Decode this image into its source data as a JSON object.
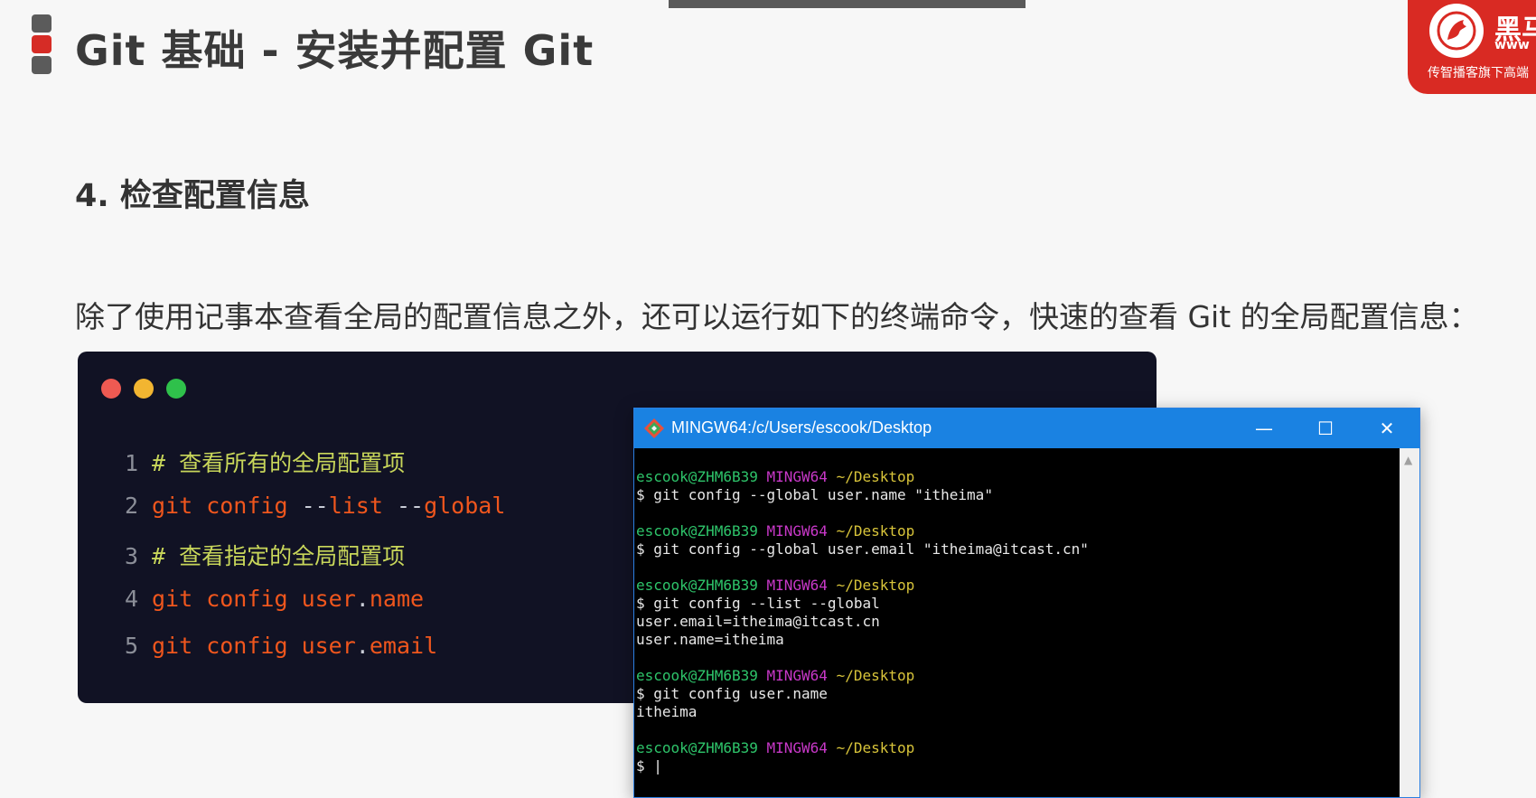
{
  "header": {
    "title": "Git 基础 - 安装并配置 Git"
  },
  "logo": {
    "mark": "黑马",
    "www": "www",
    "subtitle": "传智播客旗下高端"
  },
  "section_heading": "4. 检查配置信息",
  "intro_text": "除了使用记事本查看全局的配置信息之外，还可以运行如下的终端命令，快速的查看 Git 的全局配置信息：",
  "code_card": {
    "dot_colors": [
      "#ee5a52",
      "#f2b531",
      "#2fc14b"
    ],
    "lines": [
      {
        "num": "1",
        "comment": "# 查看所有的全局配置项"
      },
      {
        "num": "2",
        "a": "git config ",
        "b": "--",
        "c": "list ",
        "d": "--",
        "e": "global"
      },
      {
        "num": "3",
        "comment": "# 查看指定的全局配置项"
      },
      {
        "num": "4",
        "a": "git config ",
        "b": "user",
        "c": ".",
        "d": "name"
      },
      {
        "num": "5",
        "a": "git config ",
        "b": "user",
        "c": ".",
        "d": "email"
      }
    ]
  },
  "terminal": {
    "title": "MINGW64:/c/Users/escook/Desktop",
    "minimize": "—",
    "maximize": "☐",
    "close": "✕",
    "prompt_user": "escook@ZHM6B39",
    "prompt_host": "MINGW64",
    "prompt_path": "~/Desktop",
    "blocks": [
      {
        "command": "$ git config --global user.name \"itheima\"",
        "output": []
      },
      {
        "command": "$ git config --global user.email \"itheima@itcast.cn\"",
        "output": []
      },
      {
        "command": "$ git config --list --global",
        "output": [
          "user.email=itheima@itcast.cn",
          "user.name=itheima"
        ]
      },
      {
        "command": "$ git config user.name",
        "output": [
          "itheima"
        ]
      },
      {
        "command": "$ |",
        "output": []
      }
    ]
  },
  "colors": {
    "accent_red": "#d62c26",
    "terminal_titlebar": "#1a82e2",
    "code_bg": "#111224"
  }
}
